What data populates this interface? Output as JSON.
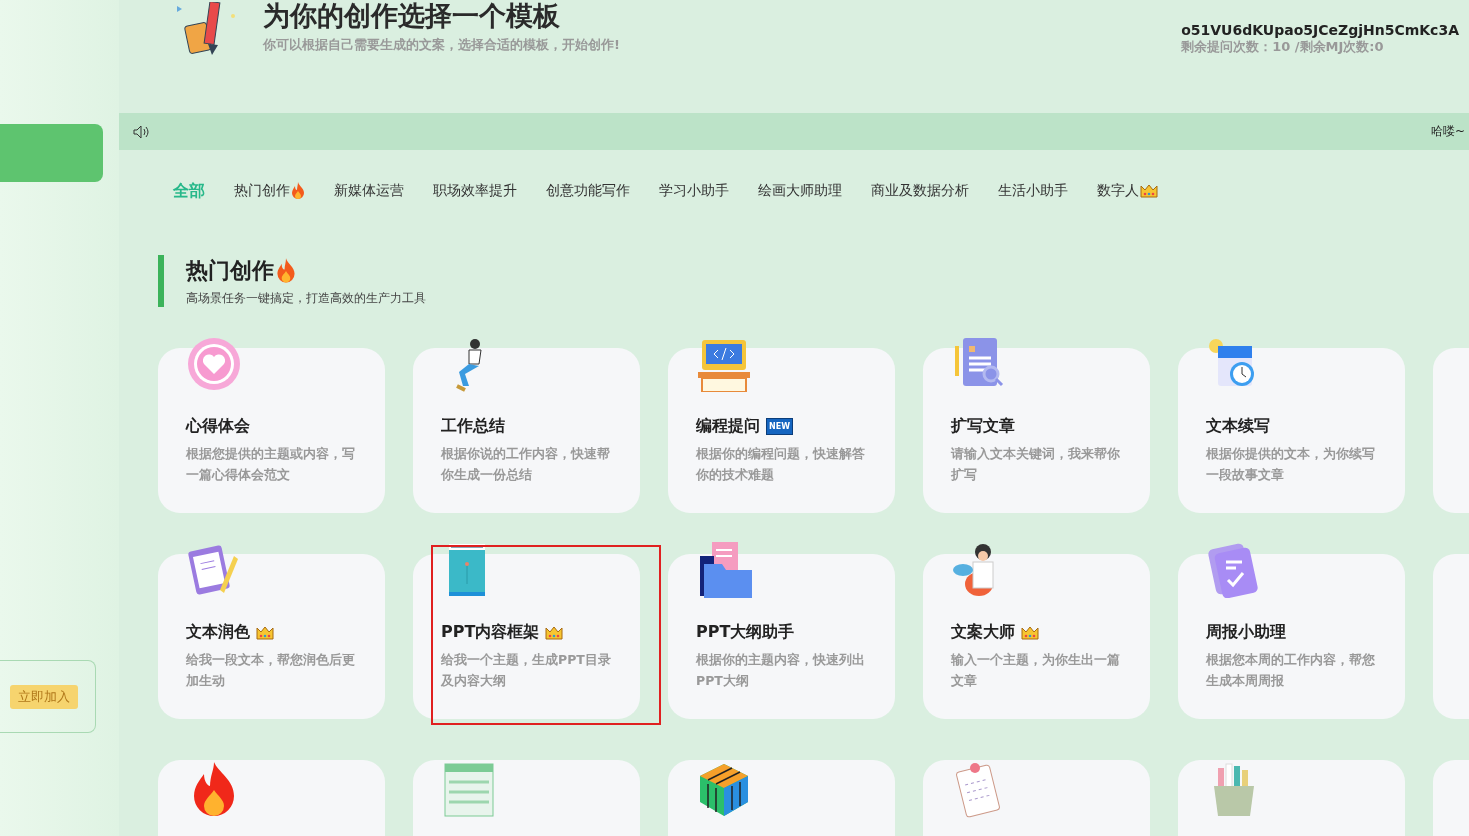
{
  "header": {
    "title": "为你的创作选择一个模板",
    "subtitle": "你可以根据自己需要生成的文案，选择合适的模板，开始创作!",
    "user_id": "o51VU6dKUpao5JCeZgjHn5CmKc3A",
    "quota": "剩余提问次数：10 /剩余MJ次数:0"
  },
  "sidebar": {
    "join_button": "立即加入"
  },
  "notice": {
    "text": "哈喽~"
  },
  "tabs": [
    {
      "label": "全部",
      "selected": true
    },
    {
      "label": "热门创作",
      "flame": true,
      "selected": false
    },
    {
      "label": "新媒体运营",
      "selected": false
    },
    {
      "label": "职场效率提升",
      "selected": false
    },
    {
      "label": "创意功能写作",
      "selected": false
    },
    {
      "label": "学习小助手",
      "selected": false
    },
    {
      "label": "绘画大师助理",
      "selected": false
    },
    {
      "label": "商业及数据分析",
      "selected": false
    },
    {
      "label": "生活小助手",
      "selected": false
    },
    {
      "label": "数字人",
      "crown": true,
      "selected": false
    }
  ],
  "section": {
    "title": "热门创作",
    "flame": true,
    "subtitle": "高场景任务一键搞定，打造高效的生产力工具"
  },
  "cards": [
    {
      "kind": "full",
      "title": "心得体会",
      "description": "根据您提供的主题或内容，写一篇心得体会范文"
    },
    {
      "kind": "full",
      "title": "工作总结",
      "description": "根据你说的工作内容，快速帮你生成一份总结"
    },
    {
      "kind": "full",
      "title": "编程提问",
      "new_badge": "NEW",
      "description": "根据你的编程问题，快速解答你的技术难题"
    },
    {
      "kind": "full",
      "title": "扩写文章",
      "description": "请输入文本关键词，我来帮你扩写"
    },
    {
      "kind": "full",
      "title": "文本续写",
      "description": "根据你提供的文本，为你续写一段故事文章"
    },
    {
      "kind": "cut"
    },
    {
      "kind": "full",
      "title": "文本润色",
      "crown": true,
      "description": "给我一段文本，帮您润色后更加生动"
    },
    {
      "kind": "full",
      "title": "PPT内容框架",
      "crown": true,
      "highlighted": true,
      "description": "给我一个主题，生成PPT目录及内容大纲"
    },
    {
      "kind": "full",
      "title": "PPT大纲助手",
      "description": "根据你的主题内容，快速列出PPT大纲"
    },
    {
      "kind": "full",
      "title": "文案大师",
      "crown": true,
      "description": "输入一个主题，为你生出一篇文章"
    },
    {
      "kind": "full",
      "title": "周报小助理",
      "description": "根据您本周的工作内容，帮您生成本周周报"
    },
    {
      "kind": "cut"
    },
    {
      "kind": "cut"
    },
    {
      "kind": "cut"
    },
    {
      "kind": "cut"
    },
    {
      "kind": "cut"
    },
    {
      "kind": "cut"
    },
    {
      "kind": "cut"
    }
  ]
}
